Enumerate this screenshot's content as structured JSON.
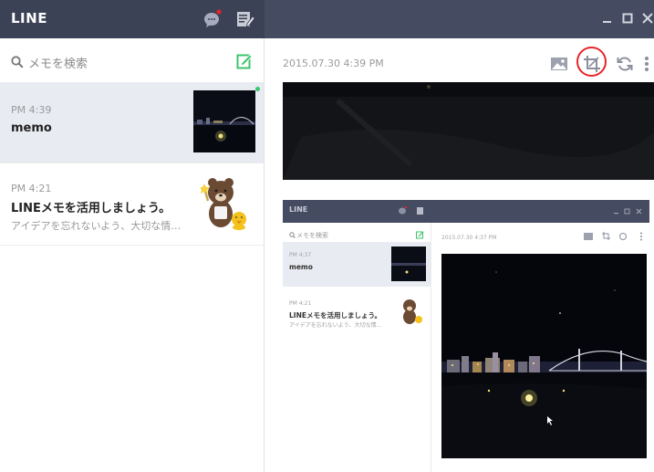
{
  "app": {
    "title": "LINE"
  },
  "search": {
    "placeholder": "メモを検索"
  },
  "memos": [
    {
      "time": "PM 4:39",
      "title": "memo",
      "preview": ""
    },
    {
      "time": "PM 4:21",
      "title": "LINEメモを活用しましょう。",
      "preview": "アイデアを忘れないよう、大切な情…"
    }
  ],
  "detail": {
    "timestamp": "2015.07.30 4:39 PM"
  },
  "icons": {
    "chat": "chat-bubble-icon",
    "compose": "compose-icon",
    "search": "search-icon",
    "new_memo": "new-memo-icon",
    "image": "image-icon",
    "crop": "crop-icon",
    "rotate": "rotate-icon",
    "more": "more-vertical-icon"
  },
  "colors": {
    "titlebar": "#3c4256",
    "titlebar_right": "#454b61",
    "selected_item": "#e9ebf2",
    "accent_green": "#3cc46e",
    "notification": "#e8242a",
    "highlight_circle": "#e8242a"
  },
  "embedded": {
    "title": "LINE",
    "search_placeholder": "メモを検索",
    "memos": [
      {
        "time": "PM 4:37",
        "title": "memo",
        "preview": ""
      },
      {
        "time": "PM 4:21",
        "title": "LINEメモを活用しましょう。",
        "preview": "アイデアを忘れないよう、大切な情…"
      }
    ],
    "timestamp": "2015.07.30 4:37 PM"
  }
}
